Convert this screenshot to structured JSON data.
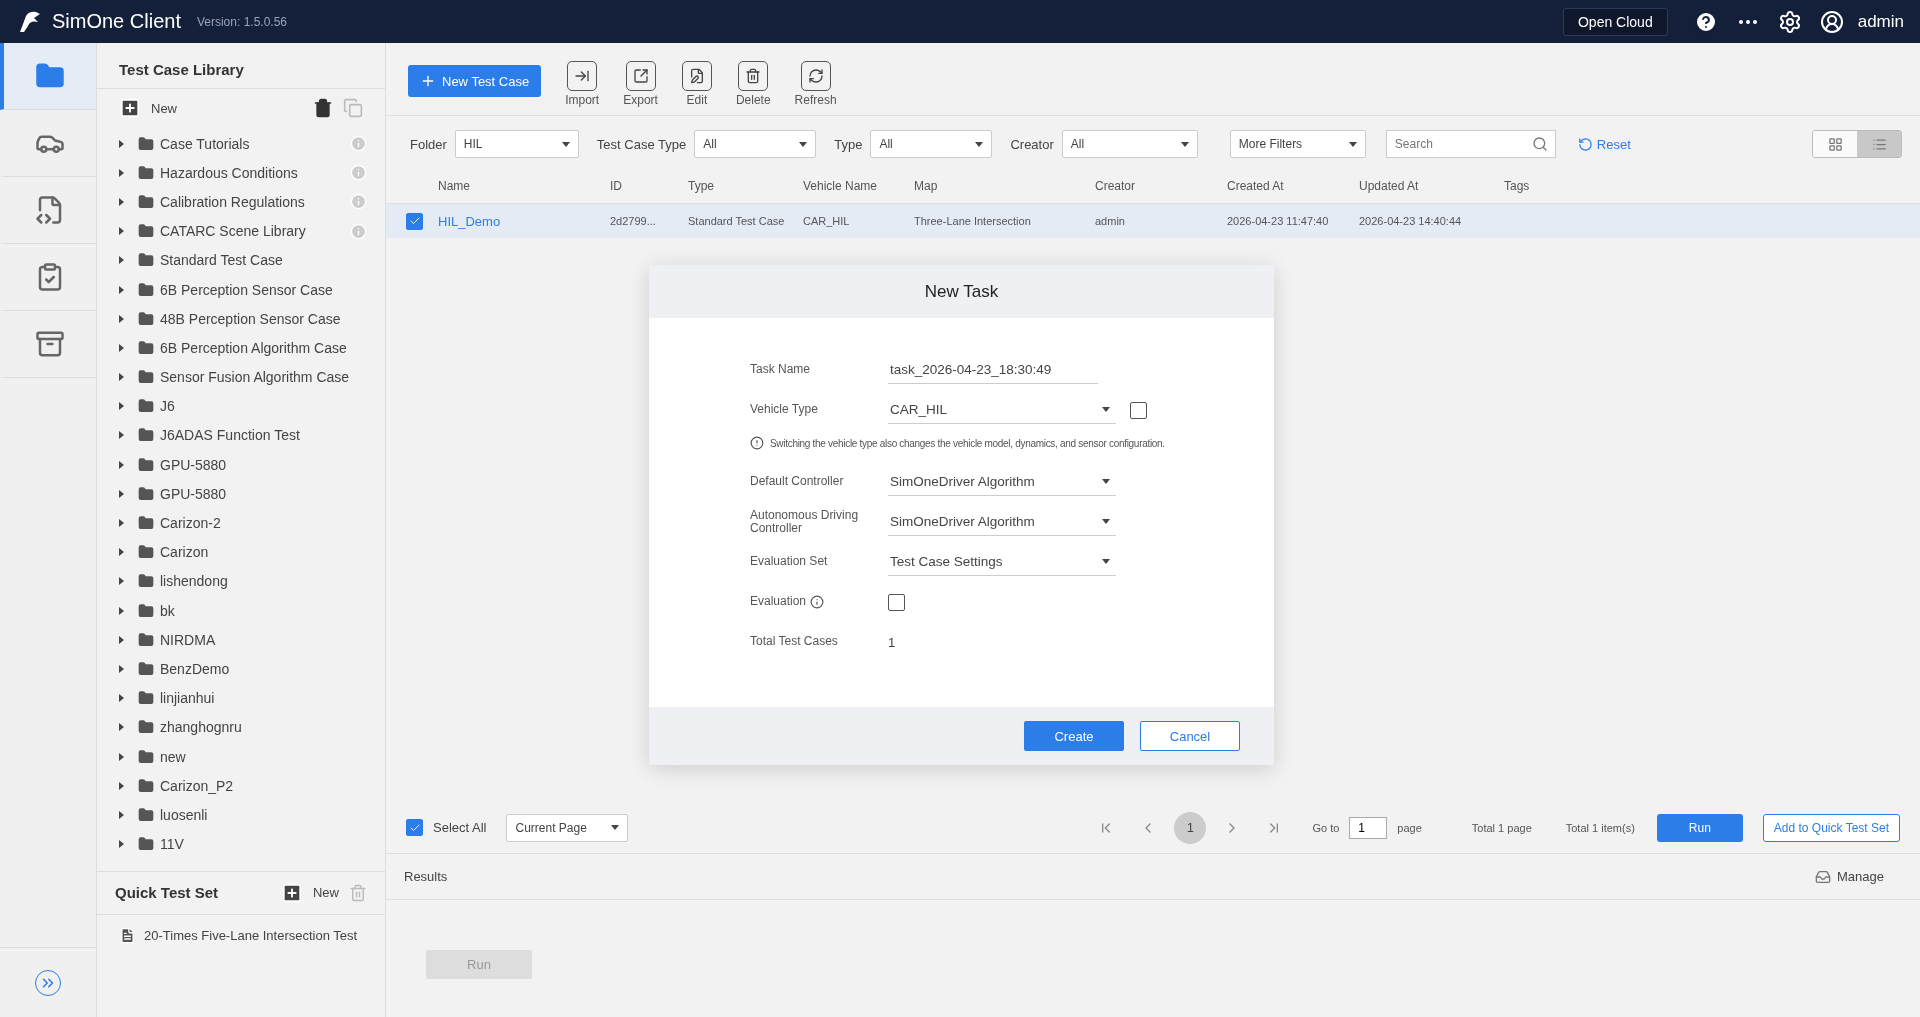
{
  "app": {
    "name": "SimOne Client",
    "version": "Version: 1.5.0.56"
  },
  "header_actions": {
    "open_cloud": "Open Cloud",
    "user": "admin"
  },
  "rail": [
    {
      "kind": "folder",
      "selected": true
    },
    {
      "kind": "car",
      "selected": false
    },
    {
      "kind": "code",
      "selected": false
    },
    {
      "kind": "clipboard",
      "selected": false
    },
    {
      "kind": "archive",
      "selected": false
    }
  ],
  "library": {
    "title": "Test Case Library",
    "new_label": "New",
    "folders": [
      {
        "label": "Case Tutorials",
        "info": true
      },
      {
        "label": "Hazardous Conditions",
        "info": true
      },
      {
        "label": "Calibration Regulations",
        "info": true
      },
      {
        "label": "CATARC Scene Library",
        "info": true
      },
      {
        "label": "Standard Test Case",
        "info": false
      },
      {
        "label": "6B Perception Sensor Case",
        "info": false
      },
      {
        "label": "48B Perception Sensor Case",
        "info": false
      },
      {
        "label": "6B Perception Algorithm Case",
        "info": false
      },
      {
        "label": "Sensor Fusion Algorithm Case",
        "info": false
      },
      {
        "label": "J6",
        "info": false
      },
      {
        "label": "J6ADAS Function Test",
        "info": false
      },
      {
        "label": "GPU-5880",
        "info": false
      },
      {
        "label": "GPU-5880",
        "info": false
      },
      {
        "label": "Carizon-2",
        "info": false
      },
      {
        "label": "Carizon",
        "info": false
      },
      {
        "label": "lishendong",
        "info": false
      },
      {
        "label": "bk",
        "info": false
      },
      {
        "label": "NIRDMA",
        "info": false
      },
      {
        "label": "BenzDemo",
        "info": false
      },
      {
        "label": "linjianhui",
        "info": false
      },
      {
        "label": "zhanghognru",
        "info": false
      },
      {
        "label": "new",
        "info": false
      },
      {
        "label": "Carizon_P2",
        "info": false
      },
      {
        "label": "luosenli",
        "info": false
      },
      {
        "label": "11V",
        "info": false
      }
    ]
  },
  "quick_test_set": {
    "title": "Quick Test Set",
    "new_label": "New",
    "items": [
      "20-Times Five-Lane Intersection Test"
    ]
  },
  "toolbar": {
    "primary": "New Test Case",
    "actions": [
      {
        "kind": "import",
        "label": "Import"
      },
      {
        "kind": "export",
        "label": "Export"
      },
      {
        "kind": "edit",
        "label": "Edit"
      },
      {
        "kind": "delete",
        "label": "Delete"
      },
      {
        "kind": "refresh",
        "label": "Refresh"
      }
    ]
  },
  "filters": [
    {
      "label": "Folder",
      "value": "HIL"
    },
    {
      "label": "Test Case Type",
      "value": "All"
    },
    {
      "label": "Type",
      "value": "All"
    },
    {
      "label": "Creator",
      "value": "All"
    }
  ],
  "more_filters": "More Filters",
  "search": {
    "placeholder": "Search"
  },
  "reset": "Reset",
  "view_toggle": [
    {
      "kind": "grid",
      "selected": false
    },
    {
      "kind": "list",
      "selected": true
    }
  ],
  "table": {
    "columns": [
      "Name",
      "ID",
      "Type",
      "Vehicle Name",
      "Map",
      "Creator",
      "Created At",
      "Updated At",
      "Tags"
    ],
    "rows": [
      {
        "selected": true,
        "cells": [
          "HIL_Demo",
          "2d2799...",
          "Standard Test Case",
          "CAR_HIL",
          "Three-Lane Intersection",
          "admin",
          "2026-04-23 11:47:40",
          "2026-04-23 14:40:44",
          ""
        ]
      }
    ]
  },
  "dialog": {
    "title": "New Task",
    "fields": [
      {
        "kind": "text",
        "label": "Task Name",
        "value": "task_2026-04-23_18:30:49"
      },
      {
        "kind": "select",
        "label": "Vehicle Type",
        "value": "CAR_HIL",
        "checkbox": false
      },
      {
        "kind": "note",
        "label": "Switching the vehicle type also changes the vehicle model, dynamics, and sensor configuration."
      },
      {
        "kind": "select",
        "label": "Default Controller",
        "value": "SimOneDriver Algorithm"
      },
      {
        "kind": "select",
        "label": "Autonomous Driving Controller",
        "value": "SimOneDriver Algorithm"
      },
      {
        "kind": "select",
        "label": "Evaluation Set",
        "value": "Test Case Settings"
      },
      {
        "kind": "check",
        "label": "Evaluation",
        "checked": false
      },
      {
        "kind": "static",
        "label": "Total Test Cases",
        "value": "1"
      }
    ],
    "create": "Create",
    "cancel": "Cancel"
  },
  "footer": {
    "select_all": {
      "label": "Select All",
      "checked": true
    },
    "scope": "Current Page",
    "pages": [
      {
        "label": "1",
        "selected": true
      }
    ],
    "goto_label": "Go to",
    "goto_value": "1",
    "page_word": "page",
    "total_pages": "Total 1 page",
    "total_items": "Total 1 item(s)",
    "run": "Run",
    "add": "Add to Quick Test Set"
  },
  "results": {
    "title": "Results",
    "manage": "Manage",
    "run": {
      "label": "Run",
      "disabled": true
    }
  }
}
